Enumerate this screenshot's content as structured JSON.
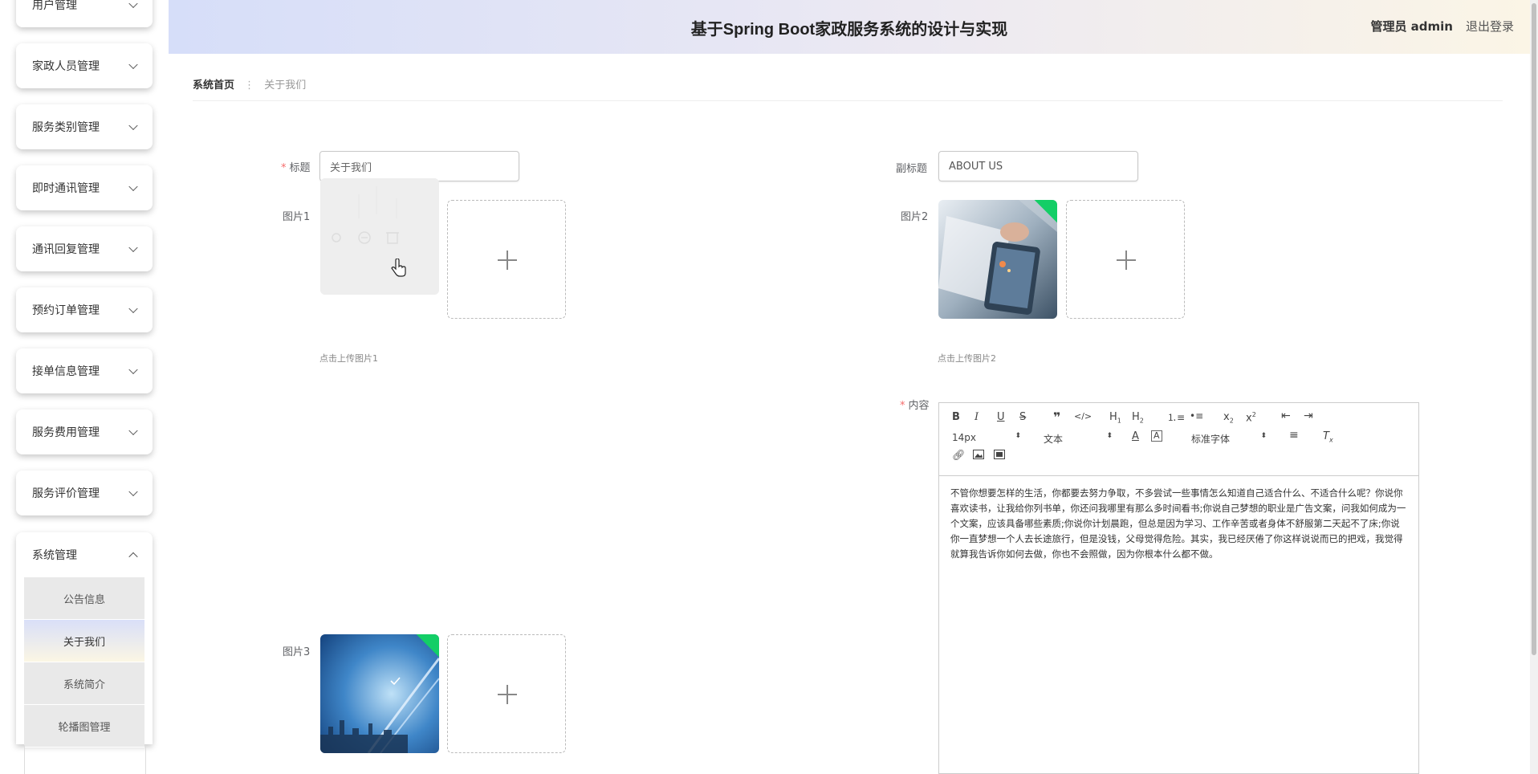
{
  "header": {
    "title": "基于Spring Boot家政服务系统的设计与实现",
    "user": "管理员 admin",
    "logout": "退出登录"
  },
  "sidebar": {
    "items": [
      {
        "label": "用户管理"
      },
      {
        "label": "家政人员管理"
      },
      {
        "label": "服务类别管理"
      },
      {
        "label": "即时通讯管理"
      },
      {
        "label": "通讯回复管理"
      },
      {
        "label": "预约订单管理"
      },
      {
        "label": "接单信息管理"
      },
      {
        "label": "服务费用管理"
      },
      {
        "label": "服务评价管理"
      }
    ],
    "open_menu": {
      "label": "系统管理",
      "children": [
        {
          "label": "公告信息",
          "active": false
        },
        {
          "label": "关于我们",
          "active": true
        },
        {
          "label": "系统简介",
          "active": false
        },
        {
          "label": "轮播图管理",
          "active": false
        }
      ]
    }
  },
  "breadcrumb": {
    "home": "系统首页",
    "current": "关于我们"
  },
  "form": {
    "title_label": "标题",
    "title_value": "关于我们",
    "subtitle_label": "副标题",
    "subtitle_value": "ABOUT US",
    "pic1_label": "图片1",
    "pic1_tip": "点击上传图片1",
    "pic2_label": "图片2",
    "pic2_tip": "点击上传图片2",
    "pic3_label": "图片3",
    "content_label": "内容"
  },
  "editor": {
    "font_size": "14px",
    "text_type": "文本",
    "font_family": "标准字体",
    "content": "不管你想要怎样的生活，你都要去努力争取，不多尝试一些事情怎么知道自己适合什么、不适合什么呢？你说你喜欢读书，让我给你列书单，你还问我哪里有那么多时间看书;你说自己梦想的职业是广告文案，问我如何成为一个文案，应该具备哪些素质;你说你计划晨跑，但总是因为学习、工作辛苦或者身体不舒服第二天起不了床;你说你一直梦想一个人去长途旅行，但是没钱，父母觉得危险。其实，我已经厌倦了你这样说说而已的把戏，我觉得就算我告诉你如何去做，你也不会照做，因为你根本什么都不做。"
  },
  "colors": {
    "required": "#f56c6c",
    "success_badge": "#13ce66"
  }
}
